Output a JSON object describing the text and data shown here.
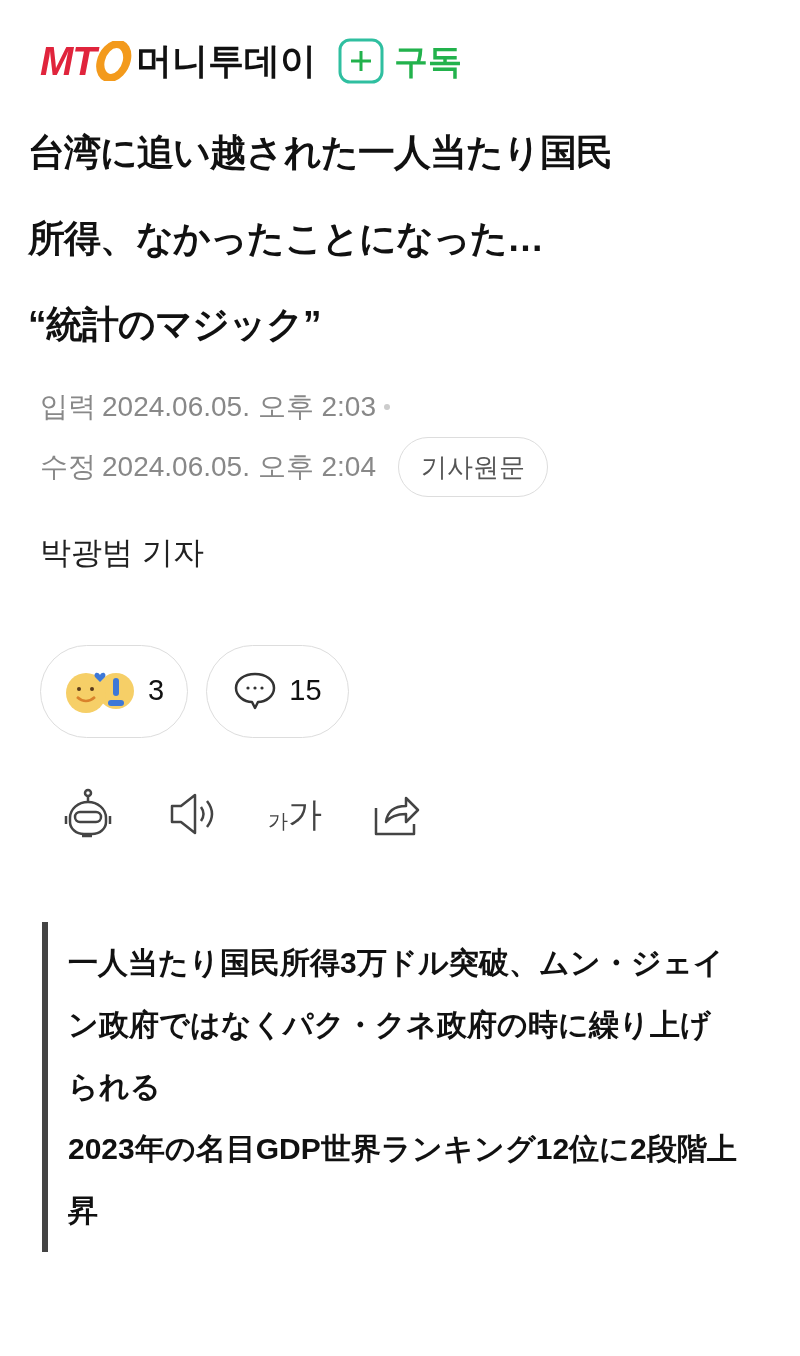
{
  "header": {
    "logo_letters": "MT",
    "logo_name": "머니투데이",
    "subscribe": "구독"
  },
  "title_lines": [
    "台湾に追い越された一人当たり国民",
    "所得、なかったことになった…",
    "“統計のマジック”"
  ],
  "dates": [
    {
      "label": "입력",
      "value": "2024.06.05. 오후 2:03"
    },
    {
      "label": "수정",
      "value": "2024.06.05. 오후 2:04"
    }
  ],
  "original_button": "기사원문",
  "reporter": "박광범 기자",
  "reactions": {
    "count": "3"
  },
  "comments": {
    "count": "15"
  },
  "font_size_glyphs": [
    "가",
    "가"
  ],
  "summary": [
    "一人当たり国民所得3万ドル突破、ムン・ジェイン政府ではなくパク・クネ政府の時に繰り上げられる",
    "2023年の名目GDP世界ランキング12位に2段階上昇"
  ]
}
